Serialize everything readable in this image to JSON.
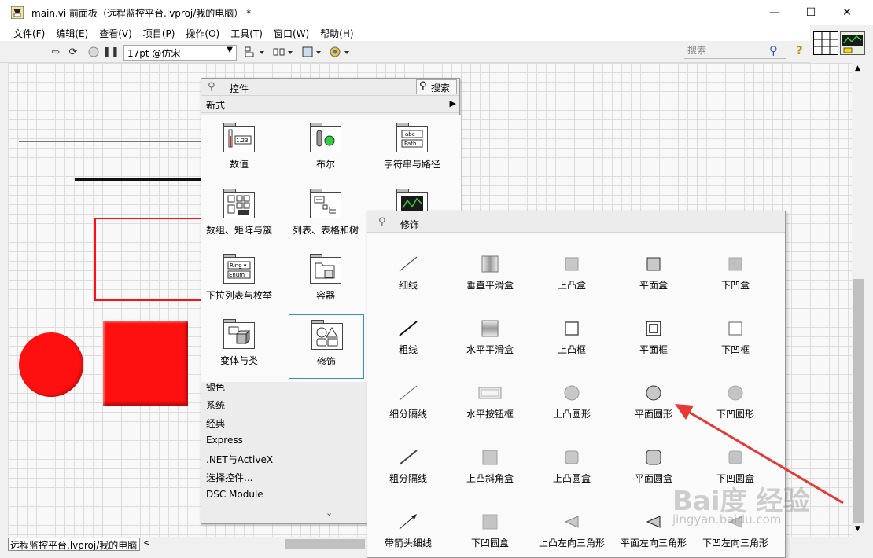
{
  "window": {
    "title": "main.vi 前面板（远程监控平台.lvproj/我的电脑）  *",
    "minimize": "—",
    "maximize": "☐",
    "close": "✕"
  },
  "menu": [
    "文件(F)",
    "编辑(E)",
    "查看(V)",
    "项目(P)",
    "操作(O)",
    "工具(T)",
    "窗口(W)",
    "帮助(H)"
  ],
  "toolbar": {
    "font_setting": "17pt @仿宋",
    "search_placeholder": "搜索"
  },
  "status_bar": "远程监控平台.lvproj/我的电脑",
  "controls_palette": {
    "title": "控件",
    "search_label": "搜索",
    "new_style": "新式",
    "categories": [
      "数值",
      "布尔",
      "字符串与路径",
      "数组、矩阵与簇",
      "列表、表格和树",
      "",
      "下拉列表与枚举",
      "容器",
      "",
      "变体与类",
      "修饰"
    ],
    "list": [
      "银色",
      "系统",
      "经典",
      "Express",
      ".NET与ActiveX",
      "选择控件...",
      "DSC Module"
    ],
    "more": "⌄"
  },
  "decorations_palette": {
    "title": "修饰",
    "items": [
      "细线",
      "垂直平滑盒",
      "上凸盒",
      "平面盒",
      "下凹盒",
      "粗线",
      "水平平滑盒",
      "上凸框",
      "平面框",
      "下凹框",
      "细分隔线",
      "水平按钮框",
      "上凸圆形",
      "平面圆形",
      "下凹圆形",
      "粗分隔线",
      "上凸斜角盒",
      "上凸圆盒",
      "平面圆盒",
      "下凹圆盒",
      "带箭头细线",
      "下凹圆盒",
      "上凸左向三角形",
      "平面左向三角形",
      "下凹左向三角形"
    ]
  },
  "colors": {
    "front_panel_red": "#ff1010",
    "annotation_arrow": "#e53935",
    "selection_blue": "#3a8dde"
  },
  "watermark": {
    "brand": "Bai度 经验",
    "url": "jingyan.baidu.com"
  }
}
